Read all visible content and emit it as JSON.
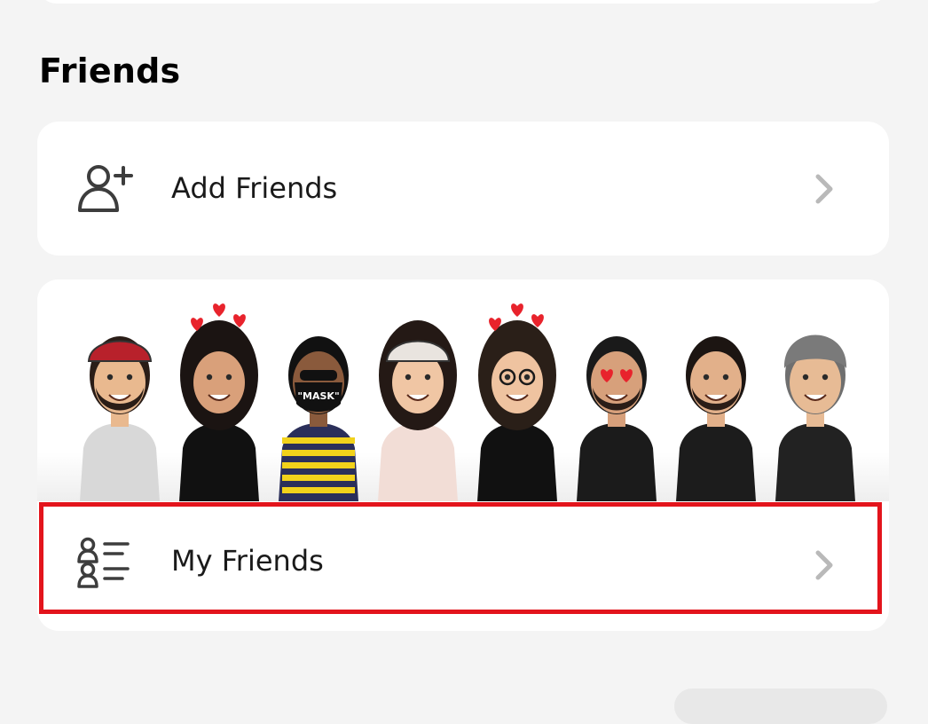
{
  "section": {
    "title": "Friends"
  },
  "rows": {
    "add_friends": {
      "label": "Add Friends",
      "icon": "add-person-icon"
    },
    "my_friends": {
      "label": "My Friends",
      "icon": "friends-list-icon"
    }
  },
  "bitmoji_strip": {
    "avatars": [
      {
        "name": "avatar-red-cap",
        "shirt": "#d8d8d8"
      },
      {
        "name": "avatar-heart-crown",
        "shirt": "#111111"
      },
      {
        "name": "avatar-mask",
        "shirt": "#2b2f5a",
        "text": "\"MASK\""
      },
      {
        "name": "avatar-white-cap",
        "shirt": "#f2ddd6"
      },
      {
        "name": "avatar-glasses",
        "shirt": "#111111"
      },
      {
        "name": "avatar-heart-eyes",
        "shirt": "#1b1b1b"
      },
      {
        "name": "avatar-floral-shirt",
        "shirt": "#1c1c1c"
      },
      {
        "name": "avatar-turban",
        "shirt": "#222222"
      }
    ]
  },
  "colors": {
    "background": "#f4f4f4",
    "card": "#ffffff",
    "highlight": "#e3141c",
    "chevron": "#b9b9b9",
    "text": "#1a1a1a"
  }
}
